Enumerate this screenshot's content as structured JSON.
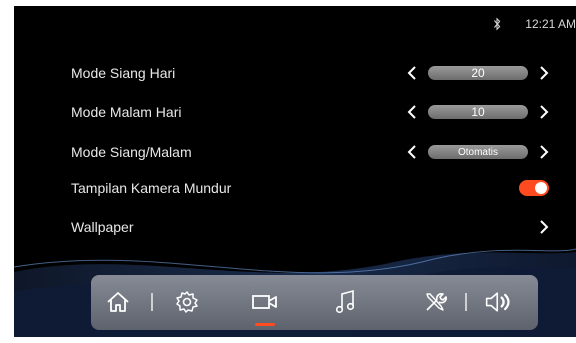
{
  "status_bar": {
    "time": "12:21 AM",
    "bluetooth_icon": "bluetooth-icon"
  },
  "settings": [
    {
      "label": "Mode Siang Hari",
      "value": "20"
    },
    {
      "label": "Mode Malam Hari",
      "value": "10"
    },
    {
      "label": "Mode Siang/Malam",
      "value": "Otomatis"
    },
    {
      "label": "Tampilan Kamera Mundur",
      "toggle_on": true
    },
    {
      "label": "Wallpaper"
    }
  ],
  "dock": {
    "items": [
      "home-icon",
      "settings-gear-icon",
      "camera-icon",
      "music-icon",
      "tools-icon",
      "volume-icon"
    ],
    "active": "camera-icon"
  },
  "colors": {
    "accent": "#ff4b1f",
    "background": "#000000",
    "dock": "#7a7f8a"
  }
}
